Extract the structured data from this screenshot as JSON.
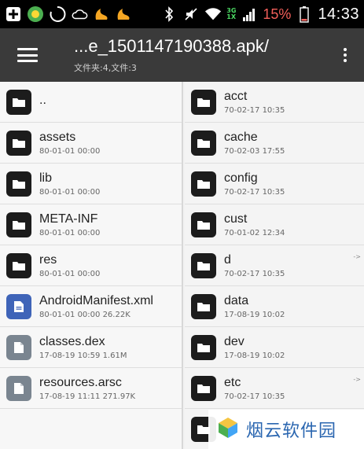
{
  "statusbar": {
    "battery": "15%",
    "time": "14:33",
    "net_top": "3G",
    "net_bottom": "1X",
    "icons": [
      "plus-box-icon",
      "app-icon",
      "sync-icon",
      "cloud-icon",
      "uc-browser-icon",
      "uc-browser-icon",
      "bluetooth-icon",
      "mute-icon",
      "wifi-icon",
      "signal-icon",
      "battery-icon"
    ]
  },
  "toolbar": {
    "title": "...e_1501147190388.apk/",
    "subtitle": "文件夹:4,文件:3",
    "menu_icon": "hamburger-icon",
    "overflow_icon": "more-vert-icon"
  },
  "left_panel": {
    "items": [
      {
        "name": "..",
        "meta": "",
        "type": "folder"
      },
      {
        "name": "assets",
        "meta": "80-01-01 00:00",
        "type": "folder"
      },
      {
        "name": "lib",
        "meta": "80-01-01 00:00",
        "type": "folder"
      },
      {
        "name": "META-INF",
        "meta": "80-01-01 00:00",
        "type": "folder"
      },
      {
        "name": "res",
        "meta": "80-01-01 00:00",
        "type": "folder"
      },
      {
        "name": "AndroidManifest.xml",
        "meta": "80-01-01 00:00  26.22K",
        "type": "xml"
      },
      {
        "name": "classes.dex",
        "meta": "17-08-19 10:59  1.61M",
        "type": "dex"
      },
      {
        "name": "resources.arsc",
        "meta": "17-08-19 11:11  271.97K",
        "type": "dex"
      }
    ]
  },
  "right_panel": {
    "items": [
      {
        "name": "acct",
        "meta": "70-02-17 10:35"
      },
      {
        "name": "cache",
        "meta": "70-02-03 17:55"
      },
      {
        "name": "config",
        "meta": "70-02-17 10:35"
      },
      {
        "name": "cust",
        "meta": "70-01-02 12:34"
      },
      {
        "name": "d",
        "meta": "70-02-17 10:35",
        "link": "->"
      },
      {
        "name": "data",
        "meta": "17-08-19 10:02"
      },
      {
        "name": "dev",
        "meta": "17-08-19 10:02"
      },
      {
        "name": "etc",
        "meta": "70-02-17 10:35",
        "link": "->"
      },
      {
        "name": "",
        "meta": ""
      }
    ]
  },
  "watermark": {
    "text": "烟云软件园"
  }
}
